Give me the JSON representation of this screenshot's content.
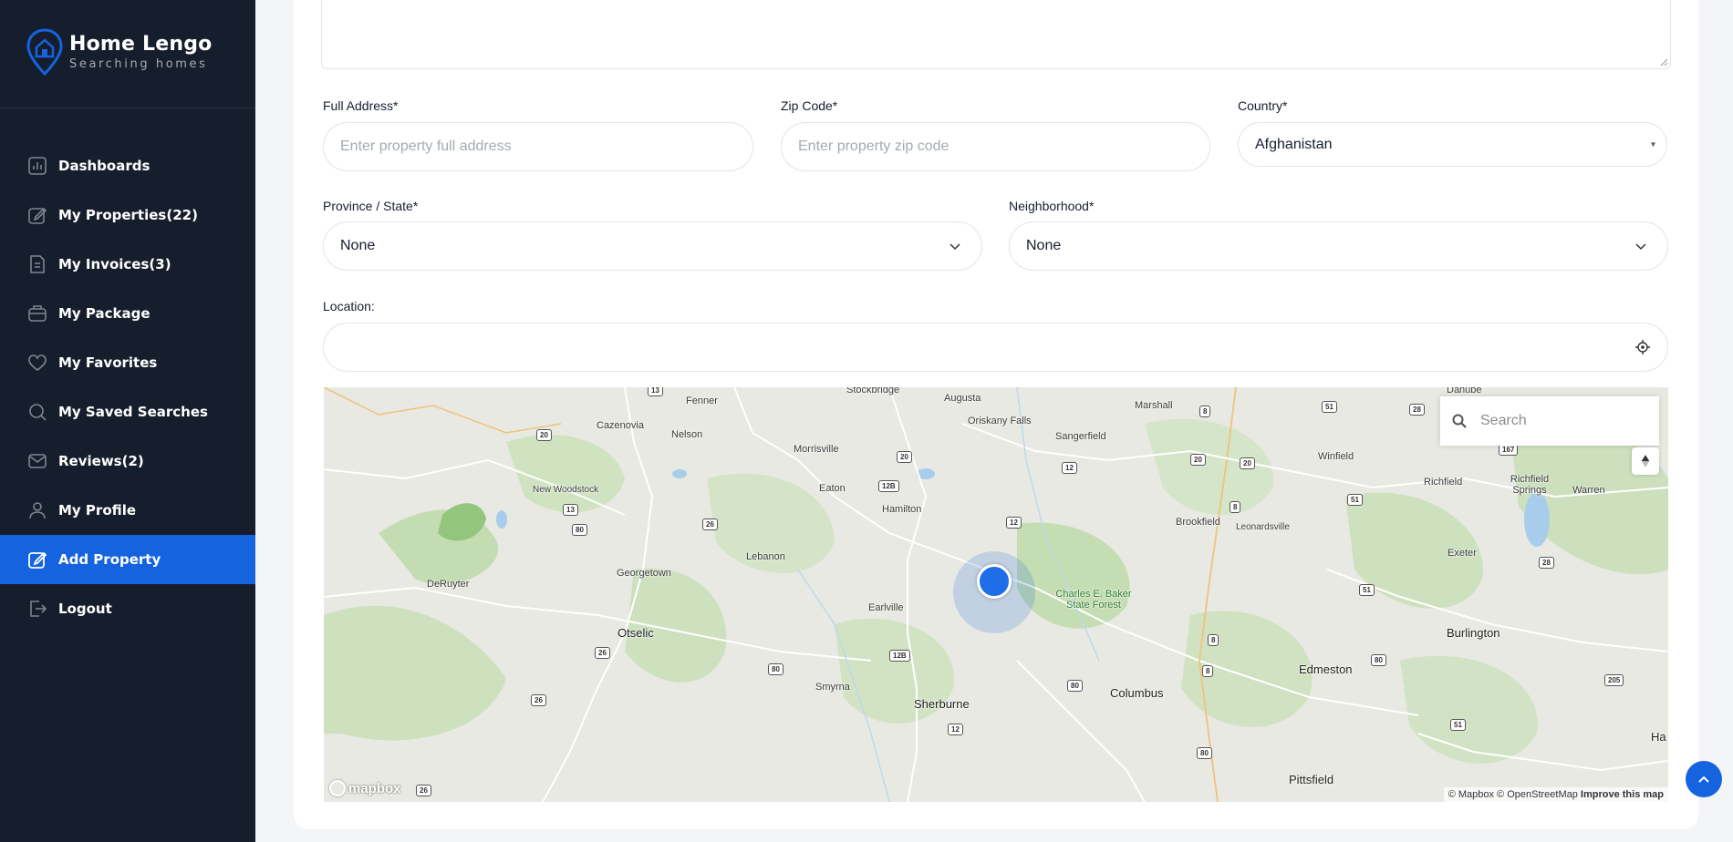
{
  "brand": {
    "title": "Home Lengo",
    "subtitle": "Searching homes"
  },
  "sidebar": {
    "items": [
      {
        "label": "Dashboards",
        "icon": "dashboard-icon"
      },
      {
        "label": "My Properties(22)",
        "icon": "edit-icon"
      },
      {
        "label": "My Invoices(3)",
        "icon": "invoice-icon"
      },
      {
        "label": "My Package",
        "icon": "package-icon"
      },
      {
        "label": "My Favorites",
        "icon": "heart-icon"
      },
      {
        "label": "My Saved Searches",
        "icon": "search-icon"
      },
      {
        "label": "Reviews(2)",
        "icon": "mail-icon"
      },
      {
        "label": "My Profile",
        "icon": "user-icon"
      },
      {
        "label": "Add Property",
        "icon": "edit-icon",
        "active": true
      },
      {
        "label": "Logout",
        "icon": "logout-icon"
      }
    ]
  },
  "form": {
    "full_address": {
      "label": "Full Address*",
      "placeholder": "Enter property full address"
    },
    "zip_code": {
      "label": "Zip Code*",
      "placeholder": "Enter property zip code"
    },
    "country": {
      "label": "Country*",
      "value": "Afghanistan"
    },
    "province": {
      "label": "Province / State*",
      "value": "None"
    },
    "neighborhood": {
      "label": "Neighborhood*",
      "value": "None"
    },
    "location": {
      "label": "Location:",
      "value": ""
    }
  },
  "map": {
    "search_placeholder": "Search",
    "brand": "mapbox",
    "attribution": "© Mapbox © OpenStreetMap",
    "improve": "Improve this map",
    "places": [
      "Stockbridge",
      "Augusta",
      "Fenner",
      "Oriskany Falls",
      "Marshall",
      "Danube",
      "Cazenovia",
      "Nelson",
      "Sangerfield",
      "Winfield",
      "Morrisville",
      "Richfield",
      "Richfield Springs",
      "Warren",
      "Eaton",
      "New Woodstock",
      "Hamilton",
      "Brookfield",
      "Leonardsville",
      "Lebanon",
      "Georgetown",
      "Exeter",
      "DeRuyter",
      "Charles E. Baker State Forest",
      "Earlville",
      "Otselic",
      "Burlington",
      "Edmeston",
      "Smyrna",
      "Sherburne",
      "Columbus",
      "Pittsfield",
      "Ha"
    ]
  },
  "colors": {
    "sidebar_bg": "#161e2d",
    "accent": "#1563df"
  }
}
